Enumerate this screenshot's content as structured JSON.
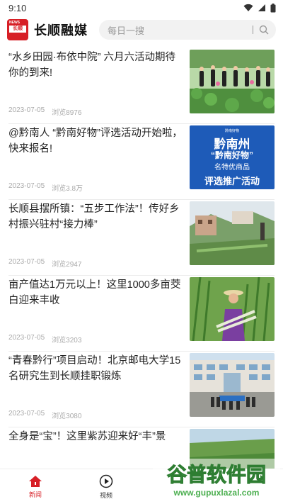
{
  "status": {
    "time": "9:10"
  },
  "header": {
    "logo_text": "长顺",
    "title": "长顺融媒",
    "search_placeholder": "每日一搜"
  },
  "feed": [
    {
      "title": "“水乡田园·布依中院” 六月六活动期待你的到来!",
      "date": "2023-07-05",
      "views": "浏览8976",
      "image": "lotus-field-photo"
    },
    {
      "title": "@黔南人 “黔南好物”评选活动开始啦，快来报名!",
      "date": "2023-07-05",
      "views": "浏览3.8万",
      "image": "promo-poster",
      "poster": {
        "line1": "黔南州",
        "line2": "“黔南好物”",
        "line3": "名特优商品",
        "line4": "评选推广活动"
      }
    },
    {
      "title": "长顺县摆所镇：“五步工作法”！传好乡村振兴驻村“接力棒”",
      "date": "2023-07-05",
      "views": "浏览2947",
      "image": "village-photo"
    },
    {
      "title": "亩产值达1万元以上！这里1000多亩茭白迎来丰收",
      "date": "2023-07-05",
      "views": "浏览3203",
      "image": "harvest-photo"
    },
    {
      "title": "“青春黔行”项目启动！北京邮电大学15名研究生到长顺挂职锻炼",
      "date": "2023-07-05",
      "views": "浏览3080",
      "image": "group-photo"
    },
    {
      "title": "全身是“宝”！这里紫苏迎来好“丰”景",
      "date": "",
      "views": "",
      "image": "field-photo"
    }
  ],
  "tabs": [
    {
      "label": "新闻",
      "icon": "home-icon",
      "active": true
    },
    {
      "label": "视频",
      "icon": "play-icon",
      "active": false
    },
    {
      "label": "",
      "icon": "",
      "active": false
    },
    {
      "label": "",
      "icon": "",
      "active": false
    }
  ],
  "watermark": {
    "brand": "谷普软件园",
    "url": "www.gupuxlazal.com"
  },
  "colors": {
    "accent": "#d71f26"
  }
}
